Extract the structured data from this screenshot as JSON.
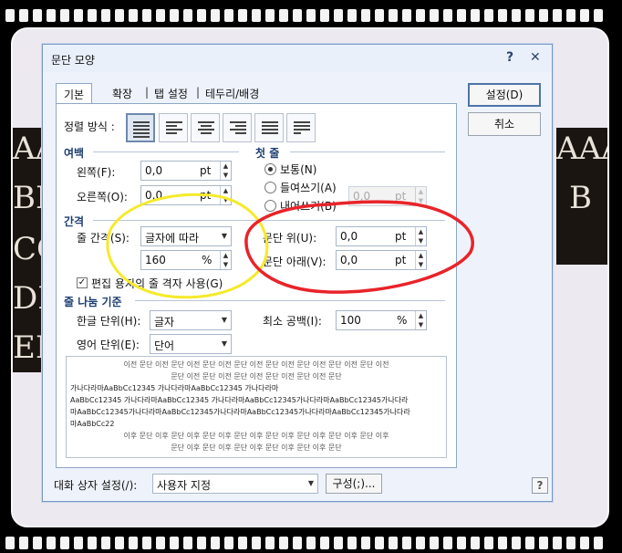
{
  "dialog": {
    "title": "문단 모양",
    "help_label": "?",
    "close_label": "✕"
  },
  "tabs": [
    "기본",
    "확장",
    "탭 설정",
    "테두리/배경"
  ],
  "tab_separator": "|",
  "alignment": {
    "label": "정렬 방식 :",
    "options": [
      "justify-icon",
      "left-align-icon",
      "center-align-icon",
      "right-align-icon",
      "distribute-icon",
      "divide-icon"
    ],
    "selected": 0
  },
  "margin": {
    "section": "여백",
    "left_label": "왼쪽(F):",
    "left_value": "0,0",
    "right_label": "오른쪽(O):",
    "right_value": "0,0",
    "unit": "pt"
  },
  "first_line": {
    "section": "첫 줄",
    "options": [
      "보통(N)",
      "들여쓰기(A)",
      "내어쓰기(B)"
    ],
    "selected": 0,
    "value": "0,0",
    "unit": "pt"
  },
  "spacing": {
    "section": "간격",
    "line_label": "줄 간격(S):",
    "line_type": "글자에 따라",
    "line_value": "160",
    "line_unit": "%",
    "before_label": "문단 위(U):",
    "before_value": "0,0",
    "after_label": "문단 아래(V):",
    "after_value": "0,0",
    "unit": "pt",
    "grid_label": "편집 용지의 줄 격자 사용(G)",
    "grid_checked": true
  },
  "line_break": {
    "section": "줄 나눔 기준",
    "korean_label": "한글 단위(H):",
    "korean_value": "글자",
    "english_label": "영어 단위(E):",
    "english_value": "단어",
    "min_space_label": "최소 공백(I):",
    "min_space_value": "100",
    "min_space_unit": "%"
  },
  "preview": {
    "lines": [
      "이전 문단 이전 문단 이전 문단 이전 문단 이전 문단 이전 문단 이전 문단 이전 문단 이전",
      "문단 이전 문단 이전 문단 이전 문단 이전 문단 이전 문단",
      "가나다라마AaBbCc12345    가나다라마AaBbCc12345    가나다라마",
      "AaBbCc12345 가나다라마AaBbCc12345 가나다라마AaBbCc12345가나다라마AaBbCc12345가나다라",
      "마AaBbCc12345가나다라마AaBbCc12345가나다라마AaBbCc12345가나다라마AaBbCc12345가나다라",
      "마AaBbCc22",
      "이후 문단 이후 문단 이후 문단 이후 문단 이후 문단 이후 문단 이후 문단 이후 문단 이후",
      "문단 이후 문단 이후 문단 이후 문단 이후 문단 이후 문단"
    ]
  },
  "footer": {
    "preset_label": "대화 상자 설정(/):",
    "preset_value": "사용자 지정",
    "compose_label": "구성(;)...",
    "help_label": "?"
  },
  "buttons": {
    "ok": "설정(D)",
    "cancel": "취소"
  },
  "background_letters": {
    "left": [
      "AA",
      "BB",
      "CC",
      "DD",
      "EE"
    ],
    "right": [
      "AAA",
      "B"
    ]
  },
  "annotation_colors": {
    "yellow": "#f5ea2a",
    "red": "#e8242a"
  }
}
